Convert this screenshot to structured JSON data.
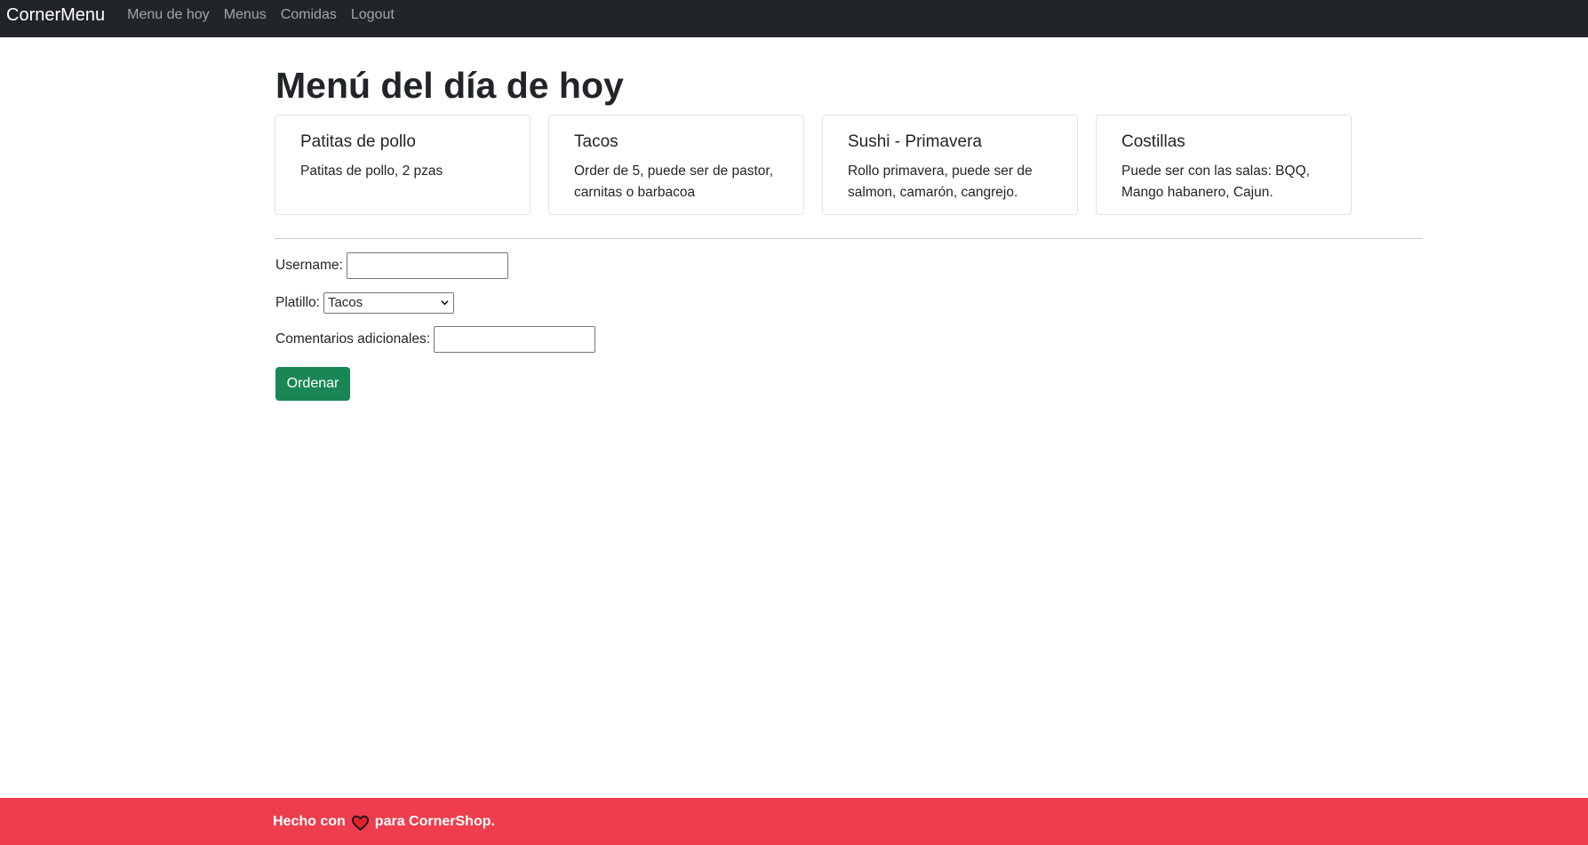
{
  "navbar": {
    "brand": "CornerMenu",
    "links": [
      "Menu de hoy",
      "Menus",
      "Comidas",
      "Logout"
    ]
  },
  "page": {
    "title": "Menú del día de hoy"
  },
  "cards": [
    {
      "title": "Patitas de pollo",
      "text": "Patitas de pollo, 2 pzas"
    },
    {
      "title": "Tacos",
      "text": "Order de 5, puede ser de pastor, carnitas o barbacoa"
    },
    {
      "title": "Sushi - Primavera",
      "text": "Rollo primavera, puede ser de salmon, camarón, cangrejo."
    },
    {
      "title": "Costillas",
      "text": "Puede ser con las salas: BQQ, Mango habanero, Cajun."
    }
  ],
  "form": {
    "username_label": "Username:",
    "username_value": "",
    "platillo_label": "Platillo:",
    "platillo_selected": "Tacos",
    "comentarios_label": "Comentarios adicionales:",
    "comentarios_value": "",
    "submit_label": "Ordenar"
  },
  "footer": {
    "prefix": "Hecho con",
    "suffix": "para CornerShop.",
    "icon": "heart-icon"
  },
  "colors": {
    "navbar_bg": "#212529",
    "button_green": "#198754",
    "footer_red": "#ee3d4d"
  }
}
